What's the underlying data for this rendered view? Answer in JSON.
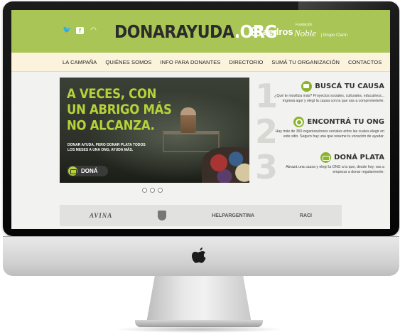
{
  "header": {
    "logo_main": "DONARAYUDA",
    "logo_suffix": ".ORG",
    "social_icons": [
      "twitter-icon",
      "facebook-icon",
      "rss-icon"
    ],
    "partner_1": "aedros",
    "partner_2_small": "Fundación",
    "partner_2_name": "Noble",
    "partner_2_group": "| Grupo Clarín"
  },
  "nav": {
    "items": [
      "LA CAMPAÑA",
      "QUIÉNES SOMOS",
      "INFO PARA DONANTES",
      "DIRECTORIO",
      "SUMÁ TU ORGANIZACIÓN",
      "CONTACTOS"
    ]
  },
  "slider": {
    "headline": "A VECES, CON UN ABRIGO MÁS NO ALCANZA.",
    "subtext": "DONAR AYUDA, PERO DONAR PLATA TODOS LOS MESES A UNA ONG, AYUDA MÁS.",
    "button_label": "DONÁ",
    "slide_count": 3
  },
  "steps": [
    {
      "number": "1",
      "title": "BUSCÁ TU CAUSA",
      "text": "¿Qué te moviliza más? Proyectos sociales, culturales, educativos... Ingresá aquí y elegí la causa con la que vas a comprometerte.",
      "icon": "monitor-icon"
    },
    {
      "number": "2",
      "title": "ENCONTRÁ TU ONG",
      "text": "Hay más de 350 organizaciones sociales entre las cuales elegir en este sitio. Seguro hay una que resume tu vocación de ayudar.",
      "icon": "magnifier-icon"
    },
    {
      "number": "3",
      "title": "DONÁ PLATA",
      "text": "Abrazá una causa y elegí la ONG a la que, desde hoy, vas a empezar a donar regularmente.",
      "icon": "donate-icon"
    }
  ],
  "partners": [
    "AVINA",
    "HELPARGENTINA",
    "RACI"
  ],
  "colors": {
    "brand_green": "#a9c556",
    "nav_bg": "#fbf3dc",
    "headline_green": "#b6d23a"
  }
}
